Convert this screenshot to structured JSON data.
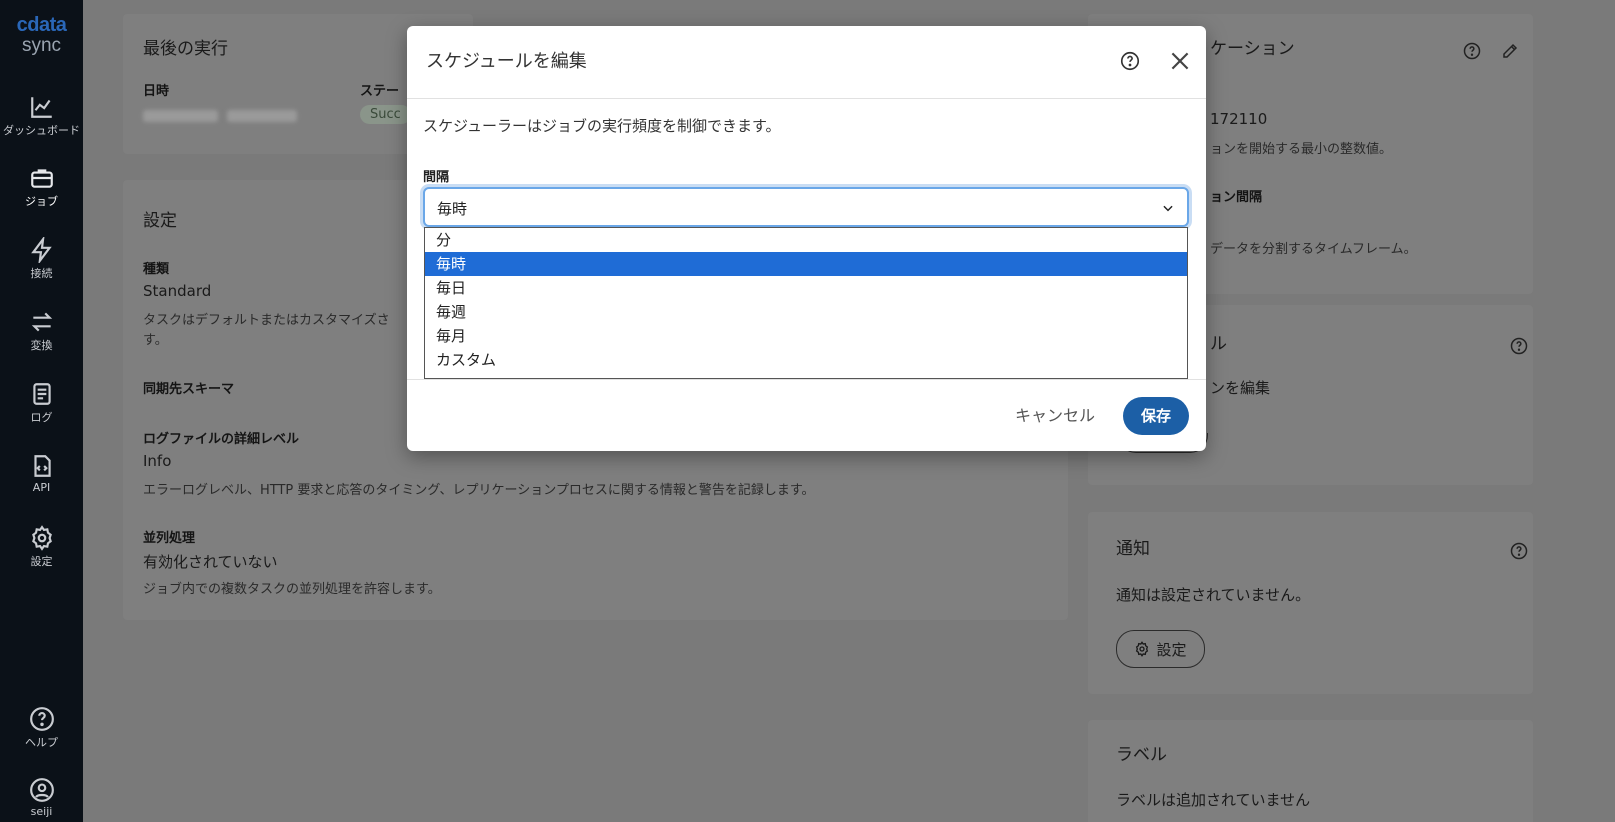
{
  "sidebar": {
    "logo_brand": "cdata",
    "logo_sub": "sync",
    "items": [
      {
        "label": "ダッシュボード",
        "icon": "chart-line-icon"
      },
      {
        "label": "ジョブ",
        "icon": "briefcase-icon"
      },
      {
        "label": "接続",
        "icon": "lightning-icon"
      },
      {
        "label": "変換",
        "icon": "swap-arrows-icon"
      },
      {
        "label": "ログ",
        "icon": "log-document-icon"
      },
      {
        "label": "API",
        "icon": "code-file-icon"
      },
      {
        "label": "設定",
        "icon": "gear-icon"
      },
      {
        "label": "ヘルプ",
        "icon": "help-circle-icon"
      },
      {
        "label": "seiji",
        "icon": "user-circle-icon"
      }
    ]
  },
  "last_run": {
    "title": "最後の実行",
    "datetime_label": "日時",
    "status_label": "ステー",
    "status_badge": "Succ"
  },
  "settings": {
    "title": "設定",
    "type_label": "種類",
    "type_value": "Standard",
    "type_desc_line1": "タスクはデフォルトまたはカスタマイズさ",
    "type_desc_line2": "す。",
    "schema_label": "同期先スキーマ",
    "log_label": "ログファイルの詳細レベル",
    "log_value": "Info",
    "log_desc": "エラーログレベル、HTTP 要求と応答のタイミング、レプリケーションプロセスに関する情報と警告を記録します。",
    "parallel_label": "並列処理",
    "parallel_value": "有効化されていない",
    "parallel_desc": "ジョブ内での複数タスクの並列処理を許容します。"
  },
  "replication": {
    "title_partial": "ケーション",
    "value_partial": "172110",
    "desc1_partial": "ョンを開始する最小の整数値。",
    "label2_partial": "ョン間隔",
    "desc2_partial": "データを分割するタイムフレーム。"
  },
  "schedule_card": {
    "title_partial": "ル",
    "edit_partial": "ンを編集"
  },
  "notifications": {
    "title": "通知",
    "empty_text": "通知は設定されていません。",
    "settings_button": "設定"
  },
  "labels": {
    "title": "ラベル",
    "empty_text": "ラベルは追加されていません"
  },
  "modal": {
    "title": "スケジュールを編集",
    "description": "スケジューラーはジョブの実行頻度を制御できます。",
    "interval_label": "間隔",
    "selected_value": "毎時",
    "options": [
      "分",
      "毎時",
      "毎日",
      "毎週",
      "毎月",
      "カスタム"
    ],
    "selected_index": 1,
    "cancel_label": "キャンセル",
    "save_label": "保存"
  },
  "colors": {
    "sidebar_bg": "#0b1118",
    "overlay_bg": "#7a7a7a",
    "primary": "#1c5fa6",
    "option_highlight": "#1f6cd6",
    "focus_ring": "#6aa7e8"
  }
}
